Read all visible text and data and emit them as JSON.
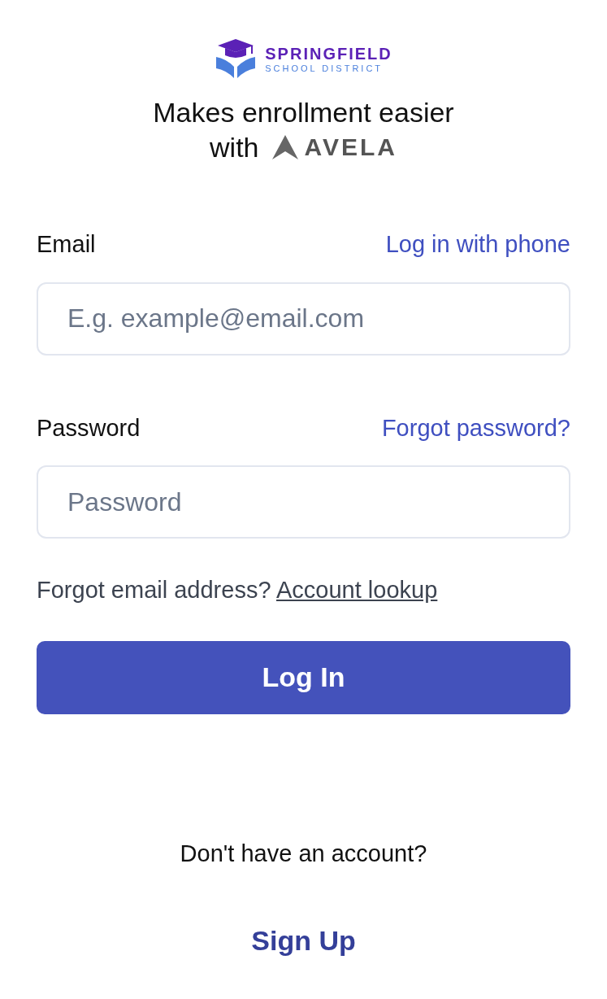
{
  "logo": {
    "name": "SPRINGFIELD",
    "subtitle": "SCHOOL DISTRICT"
  },
  "tagline": {
    "line1": "Makes enrollment easier",
    "line2": "with",
    "brand": "AVELA"
  },
  "email": {
    "label": "Email",
    "link": "Log in with phone",
    "placeholder": "E.g. example@email.com"
  },
  "password": {
    "label": "Password",
    "link": "Forgot password?",
    "placeholder": "Password"
  },
  "lookup": {
    "text": "Forgot email address?",
    "link": "Account lookup"
  },
  "login_button": "Log In",
  "signup": {
    "prompt": "Don't have an account?",
    "button": "Sign Up"
  }
}
